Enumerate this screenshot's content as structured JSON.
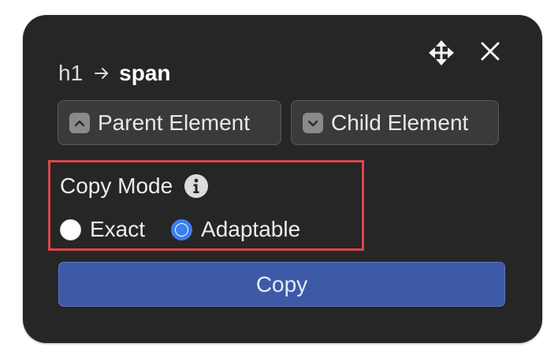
{
  "header": {
    "move_icon": "move-icon",
    "close_icon": "close-icon"
  },
  "breadcrumb": {
    "parent": "h1",
    "separator_icon": "arrow-right-icon",
    "current": "span"
  },
  "navigation": {
    "parent_label": "Parent Element",
    "parent_icon": "chevron-up-icon",
    "child_label": "Child Element",
    "child_icon": "chevron-down-icon"
  },
  "copy_mode": {
    "title": "Copy Mode",
    "info_icon": "info-icon",
    "options": [
      {
        "label": "Exact",
        "selected": false
      },
      {
        "label": "Adaptable",
        "selected": true
      }
    ],
    "highlight_color": "#d9464b"
  },
  "actions": {
    "copy_label": "Copy"
  },
  "colors": {
    "panel_background": "#262626",
    "button_background": "#3a3a3a",
    "primary_button": "#3e5aa7",
    "radio_selected": "#3c7fee"
  }
}
